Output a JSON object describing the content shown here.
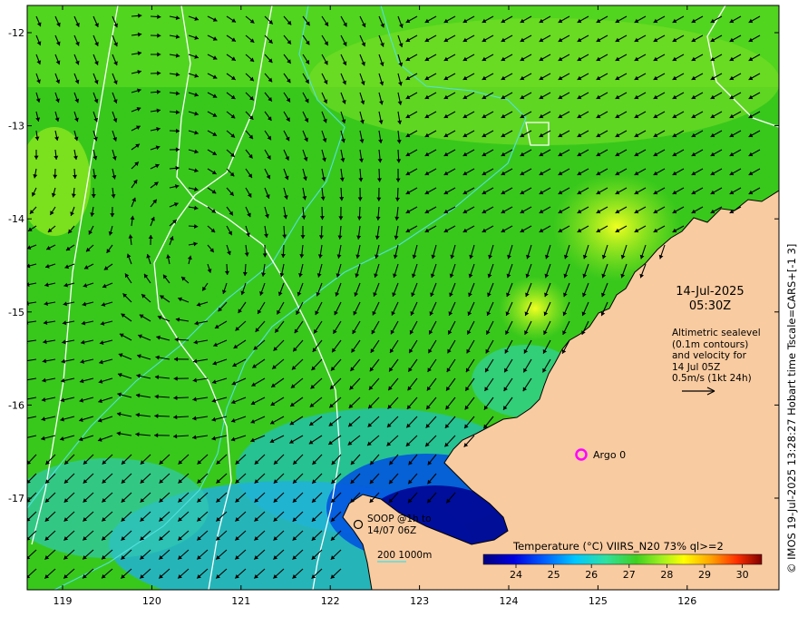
{
  "map": {
    "date": "14-Jul-2025",
    "time": "05:30Z",
    "info_lines": [
      "Altimetric sealevel",
      "(0.1m contours)",
      "and velocity for",
      "14 Jul 05Z",
      "0.5m/s (1kt 24h)"
    ],
    "argo_label": "Argo 0",
    "soop_lines": [
      "SOOP @1h to",
      "14/07 06Z"
    ],
    "depth_scale_label": "200  1000m",
    "copyright": "© IMOS 19-Jul-2025 13:28:27 Hobart time Tscale=CARS+[-1 3]",
    "x_ticks": [
      "119",
      "120",
      "121",
      "122",
      "123",
      "124",
      "125",
      "126"
    ],
    "y_ticks": [
      "-12",
      "-13",
      "-14",
      "-15",
      "-16",
      "-17"
    ],
    "colorbar": {
      "title": "Temperature (°C) VIIRS_N20 73% ql>=2",
      "ticks": [
        "24",
        "25",
        "26",
        "27",
        "28",
        "29",
        "30"
      ]
    }
  },
  "colors": {
    "land": "#f9cba0",
    "contour": "#ffffff",
    "bathymetry": "#55e0e0",
    "argo_marker": "#ff00ff",
    "arrow": "#000000"
  }
}
